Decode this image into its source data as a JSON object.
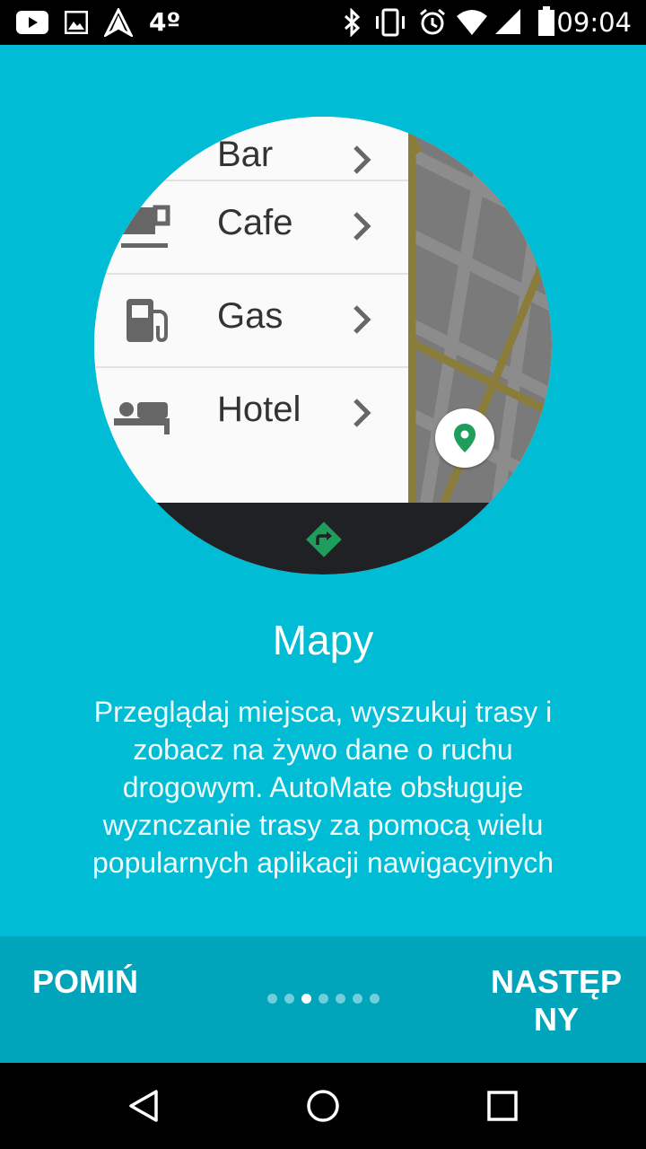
{
  "status_bar": {
    "icons_left": [
      "youtube-icon",
      "image-icon",
      "navigation-icon"
    ],
    "temperature": "4º",
    "icons_right": [
      "bluetooth-icon",
      "vibrate-icon",
      "alarm-icon",
      "wifi-icon",
      "signal-icon",
      "battery-icon"
    ],
    "time": "09:04"
  },
  "illustration": {
    "list_items": [
      {
        "label": "Bar",
        "icon": "bar-icon"
      },
      {
        "label": "Cafe",
        "icon": "cafe-icon"
      },
      {
        "label": "Gas",
        "icon": "gas-station-icon"
      },
      {
        "label": "Hotel",
        "icon": "hotel-icon"
      }
    ],
    "map_pin_icon": "map-pin-icon",
    "directions_icon": "directions-icon",
    "colors": {
      "map_background": "#7a7a7a",
      "road": "#8a7d3c",
      "pin_green": "#1e9e5a",
      "nav_dark": "#1f2125"
    }
  },
  "main": {
    "title": "Mapy",
    "description_lines": [
      "Przeglądaj miejsca, wyszukuj trasy i",
      "zobacz na żywo dane o ruchu",
      "drogowym. AutoMate obsługuje",
      "wyznczanie trasy za pomocą wielu",
      "popularnych aplikacji nawigacyjnych"
    ]
  },
  "onboarding_nav": {
    "skip_label": "POMIŃ",
    "next_label_line1": "NASTĘP",
    "next_label_line2": "NY",
    "page_count": 7,
    "current_page": 3
  },
  "system_nav": {
    "buttons": [
      "back-icon",
      "home-icon",
      "recents-icon"
    ]
  },
  "colors": {
    "background": "#00BCD4",
    "bottom_bar": "#00A5BC",
    "text": "#ffffff"
  }
}
